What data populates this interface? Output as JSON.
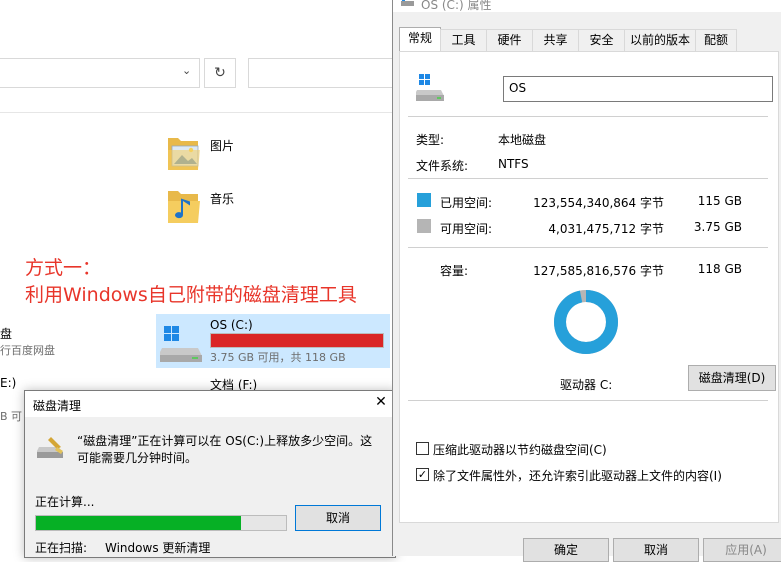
{
  "explorer": {
    "folders": [
      {
        "name": "图片",
        "icon": "pictures-folder-icon"
      },
      {
        "name": "音乐",
        "icon": "music-folder-icon"
      }
    ],
    "annotation": {
      "line1": "方式一：",
      "line2": "利用Windows自己附带的磁盘清理工具"
    },
    "drives": {
      "left_name": "盘",
      "left_sub": "行百度网盘",
      "left_e": "E:)",
      "left_b": "B 可",
      "c_name": "OS (C:)",
      "c_info": "3.75 GB 可用，共 118 GB",
      "c_used_fraction": 0.968,
      "f_name": "文档 (F:)"
    }
  },
  "cleanup_dialog": {
    "title": "磁盘清理",
    "message": "“磁盘清理”正在计算可以在 OS(C:)上释放多少空间。这可能需要几分钟时间。",
    "calc_label": "正在计算...",
    "progress_fraction": 0.82,
    "cancel_label": "取消",
    "scan_label": "正在扫描:",
    "scan_value": "Windows 更新清理"
  },
  "properties": {
    "title": "OS (C:) 属性",
    "tabs": [
      "常规",
      "工具",
      "硬件",
      "共享",
      "安全",
      "以前的版本",
      "配额"
    ],
    "active_tab": 0,
    "name_value": "OS",
    "type_label": "类型:",
    "type_value": "本地磁盘",
    "fs_label": "文件系统:",
    "fs_value": "NTFS",
    "used_label": "已用空间:",
    "used_bytes": "123,554,340,864 字节",
    "used_gb": "115 GB",
    "free_label": "可用空间:",
    "free_bytes": "4,031,475,712 字节",
    "free_gb": "3.75 GB",
    "cap_label": "容量:",
    "cap_bytes": "127,585,816,576 字节",
    "cap_gb": "118 GB",
    "used_fraction": 0.968,
    "drive_label": "驱动器 C:",
    "cleanup_button": "磁盘清理(D)",
    "compress_label": "压缩此驱动器以节约磁盘空间(C)",
    "compress_checked": false,
    "index_label": "除了文件属性外，还允许索引此驱动器上文件的内容(I)",
    "index_checked": true,
    "ok_label": "确定",
    "cancel_label": "取消",
    "apply_label": "应用(A)",
    "colors": {
      "used": "#26a0da",
      "free": "#b5b5b5"
    }
  }
}
